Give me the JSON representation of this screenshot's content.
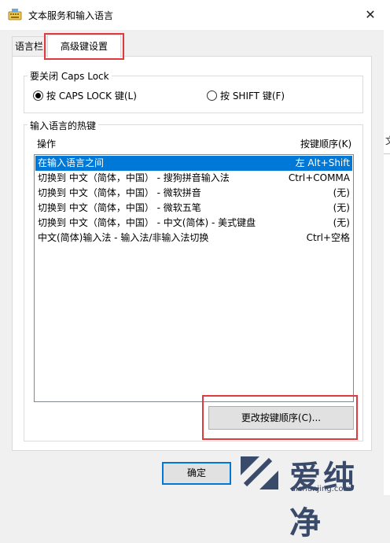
{
  "window": {
    "title": "文本服务和输入语言",
    "close_glyph": "✕"
  },
  "tabs": [
    {
      "label": "语言栏"
    },
    {
      "label": "高级键设置"
    }
  ],
  "caps_lock": {
    "group_title": "要关闭 Caps Lock",
    "options": [
      {
        "label": "按 CAPS LOCK 键(L)",
        "selected": true
      },
      {
        "label": "按 SHIFT 键(F)",
        "selected": false
      }
    ]
  },
  "hotkeys": {
    "group_title": "输入语言的热键",
    "col_action": "操作",
    "col_sequence": "按键顺序(K)",
    "rows": [
      {
        "action": "在输入语言之间",
        "keys": "左 Alt+Shift",
        "selected": true
      },
      {
        "action": "切换到 中文（简体，中国） - 搜狗拼音输入法",
        "keys": "Ctrl+COMMA",
        "selected": false
      },
      {
        "action": "切换到 中文（简体，中国） - 微软拼音",
        "keys": "(无)",
        "selected": false
      },
      {
        "action": "切换到 中文（简体，中国） - 微软五笔",
        "keys": "(无)",
        "selected": false
      },
      {
        "action": "切换到 中文（简体，中国） - 中文(简体) - 美式键盘",
        "keys": "(无)",
        "selected": false
      },
      {
        "action": "中文(简体)输入法 - 输入法/非输入法切换",
        "keys": "Ctrl+空格",
        "selected": false
      }
    ],
    "change_button": "更改按键顺序(C)..."
  },
  "footer": {
    "ok_button": "确定"
  },
  "watermark": {
    "text": "爱纯净",
    "url": "aichunjing.com"
  },
  "background_sliver": "文",
  "colors": {
    "selection": "#0078d7",
    "highlight_box": "#e0393e",
    "watermark": "#3a4a6b"
  }
}
